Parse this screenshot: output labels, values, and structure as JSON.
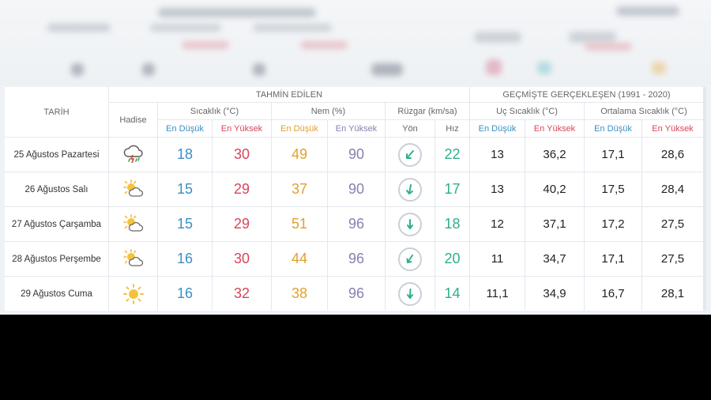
{
  "headers": {
    "tarih": "TARİH",
    "tahmin": "TAHMİN EDİLEN",
    "gecmis": "GEÇMİŞTE GERÇEKLEŞEN (1991 - 2020)",
    "hadise": "Hadise",
    "sicaklik": "Sıcaklık (°C)",
    "nem": "Nem (%)",
    "ruzgar": "Rüzgar (km/sa)",
    "uc_sicaklik": "Uç Sıcaklık (°C)",
    "ortalama_sicaklik": "Ortalama Sıcaklık (°C)",
    "en_dusuk": "En Düşük",
    "en_yuksek": "En Yüksek",
    "yon": "Yön",
    "hiz": "Hız"
  },
  "rows": [
    {
      "date": "25 Ağustos Pazartesi",
      "icon": "thunderstorm-rain-icon",
      "t_low": "18",
      "t_high": "30",
      "n_low": "49",
      "n_high": "90",
      "wind_dir": "southwest",
      "wind_speed": "22",
      "uc_low": "13",
      "uc_high": "36,2",
      "ort_low": "17,1",
      "ort_high": "28,6"
    },
    {
      "date": "26 Ağustos Salı",
      "icon": "partly-cloudy-icon",
      "t_low": "15",
      "t_high": "29",
      "n_low": "37",
      "n_high": "90",
      "wind_dir": "south",
      "wind_speed": "17",
      "uc_low": "13",
      "uc_high": "40,2",
      "ort_low": "17,5",
      "ort_high": "28,4"
    },
    {
      "date": "27 Ağustos Çarşamba",
      "icon": "partly-cloudy-icon",
      "t_low": "15",
      "t_high": "29",
      "n_low": "51",
      "n_high": "96",
      "wind_dir": "south",
      "wind_speed": "18",
      "uc_low": "12",
      "uc_high": "37,1",
      "ort_low": "17,2",
      "ort_high": "27,5"
    },
    {
      "date": "28 Ağustos Perşembe",
      "icon": "partly-cloudy-icon",
      "t_low": "16",
      "t_high": "30",
      "n_low": "44",
      "n_high": "96",
      "wind_dir": "southwest",
      "wind_speed": "20",
      "uc_low": "11",
      "uc_high": "34,7",
      "ort_low": "17,1",
      "ort_high": "27,5"
    },
    {
      "date": "29 Ağustos Cuma",
      "icon": "sunny-icon",
      "t_low": "16",
      "t_high": "32",
      "n_low": "38",
      "n_high": "96",
      "wind_dir": "south",
      "wind_speed": "14",
      "uc_low": "11,1",
      "uc_high": "34,9",
      "ort_low": "16,7",
      "ort_high": "28,1"
    }
  ]
}
